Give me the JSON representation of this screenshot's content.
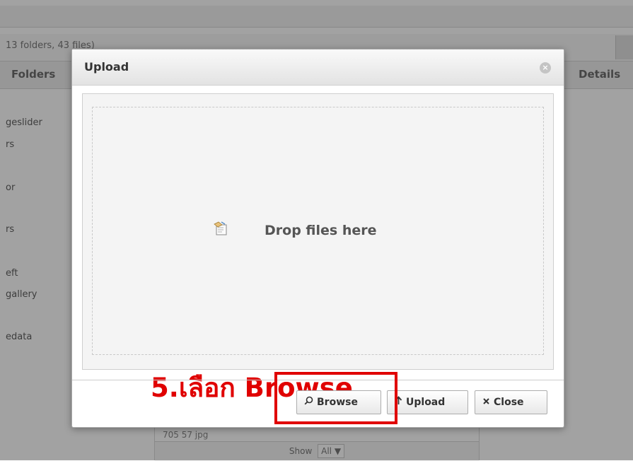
{
  "background": {
    "info": "13 folders, 43 files)",
    "folders_header": "Folders",
    "details_header": "Details",
    "folders": [
      "geslider",
      "rs",
      "or",
      "rs",
      "eft",
      "gallery",
      "edata"
    ],
    "file_row": "705 57 jpg",
    "show_label": "Show",
    "show_value": "All ▼"
  },
  "dialog": {
    "title": "Upload",
    "close_x": "×",
    "drop_text": "Drop files here",
    "annotation_step": "5.",
    "annotation_text": "เลือก Browse",
    "buttons": {
      "browse": "Browse",
      "upload": "Upload",
      "close": "Close"
    }
  },
  "colors": {
    "annotation": "#e00000",
    "overlay": "rgba(70,70,70,0.5)"
  },
  "icons": {
    "browse": "search-icon",
    "upload": "upload-arrow-icon",
    "close": "close-x-icon",
    "drop": "file-drop-icon"
  }
}
